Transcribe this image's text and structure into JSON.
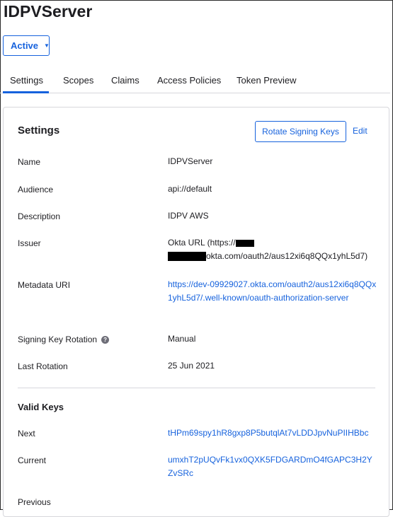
{
  "page": {
    "title": "IDPVServer"
  },
  "status": {
    "label": "Active",
    "caret": "▼"
  },
  "tabs": [
    {
      "label": "Settings",
      "active": true
    },
    {
      "label": "Scopes"
    },
    {
      "label": "Claims"
    },
    {
      "label": "Access Policies"
    },
    {
      "label": "Token Preview"
    }
  ],
  "settings_card": {
    "title": "Settings",
    "rotate_label": "Rotate Signing Keys",
    "edit_label": "Edit",
    "rows": {
      "name": {
        "label": "Name",
        "value": "IDPVServer"
      },
      "audience": {
        "label": "Audience",
        "value": "api://default"
      },
      "description": {
        "label": "Description",
        "value": "IDPV AWS"
      },
      "issuer": {
        "label": "Issuer",
        "value_prefix": "Okta URL (https://",
        "value_suffix": "okta.com/oauth2/aus12xi6q8QQx1yhL5d7)"
      },
      "metadata": {
        "label": "Metadata URI",
        "value": "https://dev-09929027.okta.com/oauth2/aus12xi6q8QQx1yhL5d7/.well-known/oauth-authorization-server"
      },
      "rotation": {
        "label": "Signing Key Rotation",
        "value": "Manual",
        "help_icon": "question-icon"
      },
      "last_rotation": {
        "label": "Last Rotation",
        "value": "25 Jun 2021"
      }
    }
  },
  "valid_keys": {
    "title": "Valid Keys",
    "next": {
      "label": "Next",
      "value": "tHPm69spy1hR8gxp8P5butqlAt7vLDDJpvNuPIIHBbc"
    },
    "current": {
      "label": "Current",
      "value": "umxhT2pUQvFk1vx0QXK5FDGARDmO4fGAPC3H2YZvSRc"
    },
    "previous": {
      "label": "Previous"
    }
  },
  "colors": {
    "accent": "#1662dd",
    "text": "#1d1d21",
    "border": "#d7d7dc"
  }
}
